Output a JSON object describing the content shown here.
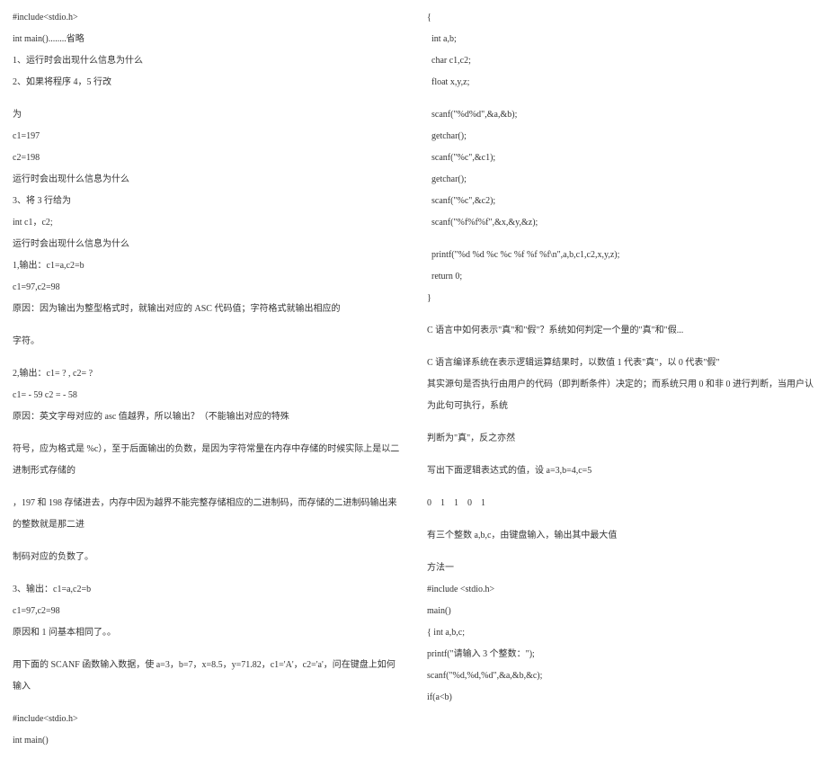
{
  "left": [
    "#include<stdio.h>",
    "int main()........省略",
    "1、运行时会出现什么信息为什么",
    "2、如果将程序 4，5 行改",
    "",
    "为",
    "c1=197",
    "c2=198",
    "运行时会出现什么信息为什么",
    "3、将 3 行给为",
    "int c1，c2;",
    "运行时会出现什么信息为什么",
    "1,输出：c1=a,c2=b",
    "c1=97,c2=98",
    "原因：因为输出为整型格式时，就输出对应的 ASC 代码值；字符格式就输出相应的",
    "",
    "字符。",
    "",
    "2,输出：c1= ? , c2= ?",
    "c1= - 59 c2 = - 58",
    "原因：英文字母对应的 asc 值越界，所以输出？（不能输出对应的特殊",
    "",
    "符号，应为格式是 %c），至于后面输出的负数，是因为字符常量在内存中存储的时候实际上是以二进制形式存储的",
    "",
    "，197 和 198 存储进去，内存中因为越界不能完整存储相应的二进制码，而存储的二进制码输出来的整数就是那二进",
    "",
    "制码对应的负数了。",
    "",
    "3、输出：c1=a,c2=b",
    "c1=97,c2=98",
    "原因和 1 问基本相同了。。",
    "",
    "用下面的 SCANF 函数输入数据，使 a=3，b=7，x=8.5，y=71.82，c1='A'，c2='a'，问在键盘上如何输入",
    "",
    "#include<stdio.h>",
    "int main()"
  ],
  "right": [
    "{",
    "  int a,b;",
    "  char c1,c2;",
    "  float x,y,z;",
    "",
    "  scanf(\"%d%d\",&a,&b);",
    "  getchar();",
    "  scanf(\"%c\",&c1);",
    "  getchar();",
    "  scanf(\"%c\",&c2);",
    "  scanf(\"%f%f%f\",&x,&y,&z);",
    "",
    "  printf(\"%d %d %c %c %f %f %f\\n\",a,b,c1,c2,x,y,z);",
    "  return 0;",
    "}",
    "",
    "C 语言中如何表示\"真\"和\"假\"？系统如何判定一个量的\"真\"和\"假...",
    "",
    "C 语言编译系统在表示逻辑运算结果时，以数值 1 代表\"真\"，以 0 代表\"假\"",
    "其实源句是否执行由用户的代码（即判断条件）决定的；而系统只用 0 和非 0 进行判断，当用户认为此句可执行，系统",
    "",
    "判断为\"真\"，反之亦然",
    "",
    "写出下面逻辑表达式的值，设 a=3,b=4,c=5",
    "",
    "0    1    1    0    1",
    "",
    "有三个整数 a,b,c，由键盘输入，输出其中最大值",
    "",
    "方法一",
    "#include <stdio.h>",
    "main()",
    "{ int a,b,c;",
    "printf(\"请输入 3 个整数：\");",
    "scanf(\"%d,%d,%d\",&a,&b,&c);",
    "if(a<b)"
  ]
}
